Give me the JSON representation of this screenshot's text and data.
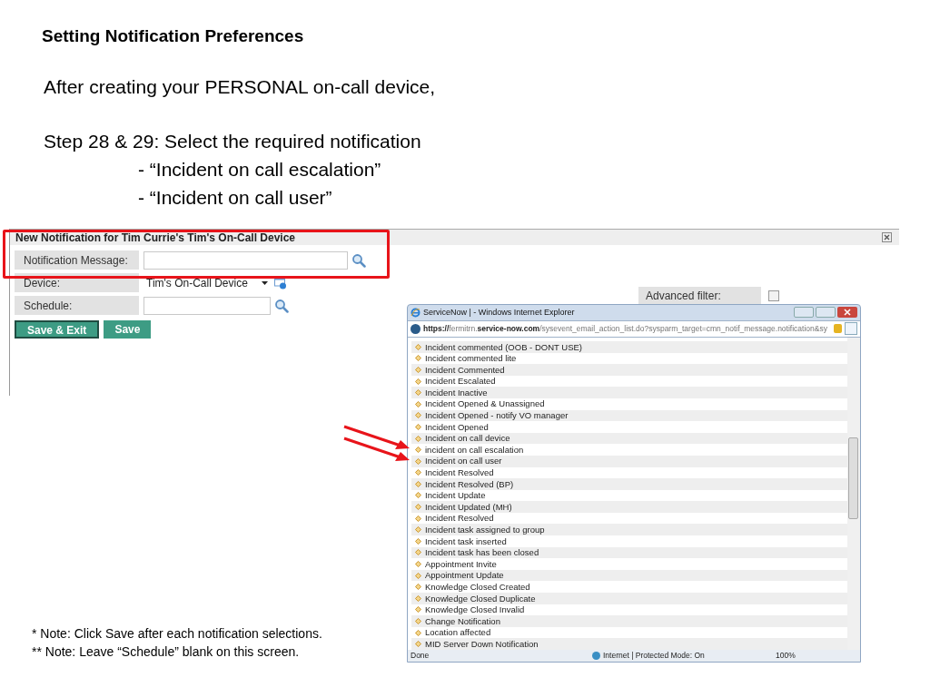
{
  "slide": {
    "title": "Setting Notification Preferences",
    "intro": "After creating your PERSONAL on-call device,",
    "step": "Step 28 & 29: Select the required notification",
    "required": [
      "- “Incident on call escalation”",
      "- “Incident on call user”"
    ],
    "notes": [
      "* Note: Click Save after each notification selections.",
      "** Note: Leave “Schedule” blank on this screen."
    ]
  },
  "dialog": {
    "title": "New Notification for Tim Currie's Tim's On-Call Device",
    "highlighted": true,
    "fields": [
      {
        "kind": "lookup",
        "label": "Notification Message:"
      },
      {
        "kind": "select",
        "label": "Device:",
        "value": "Tim's On-Call Device"
      },
      {
        "kind": "lookup",
        "label": "Schedule:"
      }
    ],
    "advanced_filter": {
      "label": "Advanced filter:",
      "checked": false
    },
    "buttons": [
      "Save & Exit",
      "Save"
    ]
  },
  "popup": {
    "title": "ServiceNow | - Windows Internet Explorer",
    "url": "**https://**fermitrn.**service-now.com**/sysevent_email_action_list.do?sysparm_target=cmn_notif_message.notification&sy",
    "items": [
      {
        "label": "Incident commented (OOB - DONT USE)",
        "arrow": false
      },
      {
        "label": "Incident commented lite",
        "arrow": false
      },
      {
        "label": "Incident Commented",
        "arrow": false
      },
      {
        "label": "Incident Escalated",
        "arrow": false
      },
      {
        "label": "Incident Inactive",
        "arrow": false
      },
      {
        "label": "Incident Opened & Unassigned",
        "arrow": false
      },
      {
        "label": "Incident Opened - notify VO manager",
        "arrow": false
      },
      {
        "label": "Incident Opened",
        "arrow": false
      },
      {
        "label": "Incident on call device",
        "arrow": false
      },
      {
        "label": "incident on call escalation",
        "arrow": true
      },
      {
        "label": "Incident on call user",
        "arrow": true
      },
      {
        "label": "Incident Resolved",
        "arrow": false
      },
      {
        "label": "Incident Resolved (BP)",
        "arrow": false
      },
      {
        "label": "Incident Update",
        "arrow": false
      },
      {
        "label": "Incident Updated (MH)",
        "arrow": false
      },
      {
        "label": "Incident Resolved",
        "arrow": false
      },
      {
        "label": "Incident task assigned to group",
        "arrow": false
      },
      {
        "label": "Incident task inserted",
        "arrow": false
      },
      {
        "label": "Incident task has been closed",
        "arrow": false
      },
      {
        "label": "Appointment Invite",
        "arrow": false
      },
      {
        "label": "Appointment Update",
        "arrow": false
      },
      {
        "label": "Knowledge Closed Created",
        "arrow": false
      },
      {
        "label": "Knowledge Closed Duplicate",
        "arrow": false
      },
      {
        "label": "Knowledge Closed Invalid",
        "arrow": false
      },
      {
        "label": "Change Notification",
        "arrow": false
      },
      {
        "label": "Location affected",
        "arrow": false
      },
      {
        "label": "MID Server Down Notification",
        "arrow": false
      }
    ],
    "status": {
      "text": "Done",
      "zone": "Internet | Protected Mode: On",
      "zoom": "100%"
    }
  }
}
